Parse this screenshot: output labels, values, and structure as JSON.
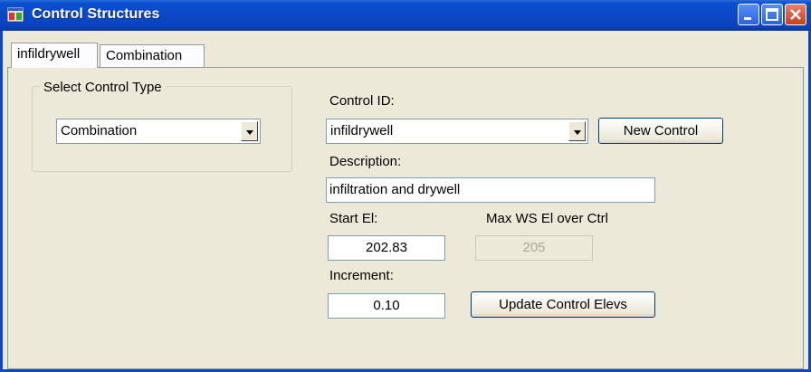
{
  "window": {
    "title": "Control Structures"
  },
  "tabs": [
    {
      "label": "infildrywell",
      "active": true
    },
    {
      "label": "Combination",
      "active": false
    }
  ],
  "control_type": {
    "legend": "Select Control Type",
    "selected": "Combination"
  },
  "control_id": {
    "label": "Control ID:",
    "selected": "infildrywell",
    "new_button": "New Control"
  },
  "description": {
    "label": "Description:",
    "value": "infiltration and drywell"
  },
  "start_el": {
    "label": "Start El:",
    "value": "202.83"
  },
  "max_ws": {
    "label": "Max WS El over Ctrl",
    "value": "205"
  },
  "increment": {
    "label": "Increment:",
    "value": "0.10"
  },
  "update_button": "Update Control Elevs"
}
